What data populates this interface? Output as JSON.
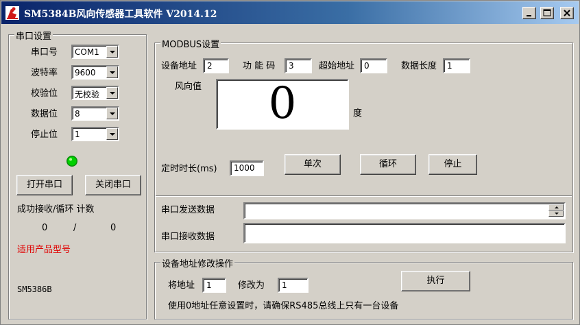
{
  "window": {
    "title": "SM5384B风向传感器工具软件 V2014.12"
  },
  "serial": {
    "group_title": "串口设置",
    "port_label": "串口号",
    "port_value": "COM1",
    "baud_label": "波特率",
    "baud_value": "9600",
    "parity_label": "校验位",
    "parity_value": "无校验",
    "databits_label": "数据位",
    "databits_value": "8",
    "stopbits_label": "停止位",
    "stopbits_value": "1",
    "status_color": "#00d000",
    "open_button": "打开串口",
    "close_button": "关闭串口",
    "counter_label": "成功接收/循环 计数",
    "success_count": "0",
    "counter_sep": "/",
    "loop_count": "0",
    "products_label": "适用产品型号",
    "product_model": "SM5386B"
  },
  "modbus": {
    "group_title": "MODBUS设置",
    "device_addr_label": "设备地址",
    "device_addr_value": "2",
    "function_code_label": "功 能 码",
    "function_code_value": "3",
    "start_addr_label": "超始地址",
    "start_addr_value": "0",
    "data_length_label": "数据长度",
    "data_length_value": "1",
    "direction_label": "风向值",
    "direction_value": "0",
    "unit_label": "度",
    "timer_label": "定时时长(ms)",
    "timer_value": "1000",
    "single_button": "单次",
    "loop_button": "循环",
    "stop_button": "停止",
    "send_label": "串口发送数据",
    "send_value": "",
    "receive_label": "串口接收数据",
    "receive_value": ""
  },
  "address_change": {
    "group_title": "设备地址修改操作",
    "from_label": "将地址",
    "from_value": "1",
    "to_label": "修改为",
    "to_value": "1",
    "execute_button": "执行",
    "note": "使用0地址任意设置时，请确保RS485总线上只有一台设备"
  }
}
